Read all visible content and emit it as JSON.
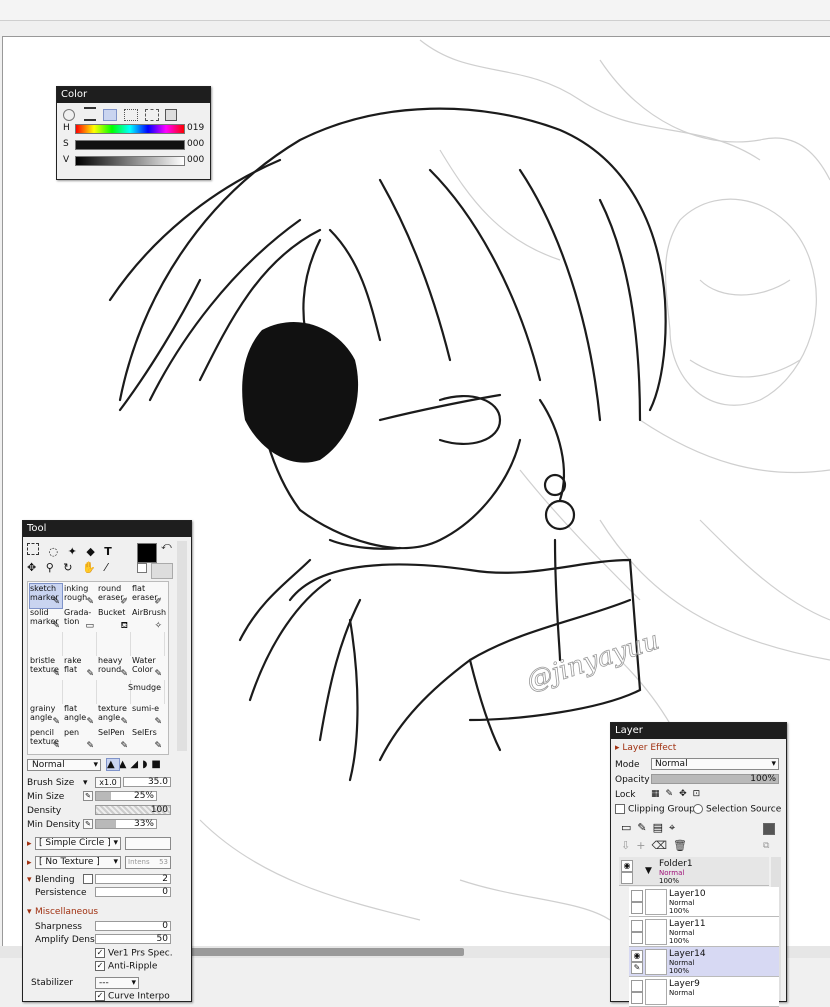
{
  "color_panel": {
    "title": "Color",
    "modes": [
      "wheel-icon",
      "rgb-sliders-icon",
      "hsv-sliders-icon",
      "grid-icon",
      "swatch-icon",
      "scratch-icon"
    ],
    "h": {
      "label": "H",
      "value": "019"
    },
    "s": {
      "label": "S",
      "value": "000"
    },
    "v": {
      "label": "V",
      "value": "000"
    }
  },
  "tool_panel": {
    "title": "Tool",
    "tools": [
      {
        "l1": "sketch",
        "l2": "marker",
        "sel": true
      },
      {
        "l1": "inking",
        "l2": "rough",
        "sel": false
      },
      {
        "l1": "round",
        "l2": "eraser",
        "sel": false
      },
      {
        "l1": "flat",
        "l2": "eraser",
        "sel": false
      },
      {
        "l1": "solid",
        "l2": "marker",
        "sel": false
      },
      {
        "l1": "Grada-",
        "l2": "tion",
        "sel": false
      },
      {
        "l1": "Bucket",
        "l2": "",
        "sel": false
      },
      {
        "l1": "AirBrush",
        "l2": "",
        "sel": false
      },
      {
        "l1": "bristle",
        "l2": "texture",
        "sel": false
      },
      {
        "l1": "rake",
        "l2": "flat",
        "sel": false
      },
      {
        "l1": "heavy",
        "l2": "round",
        "sel": false
      },
      {
        "l1": "Water",
        "l2": "Color",
        "sel": false
      },
      {
        "l1": "grainy",
        "l2": "angle",
        "sel": false
      },
      {
        "l1": "flat",
        "l2": "angle",
        "sel": false
      },
      {
        "l1": "texture",
        "l2": "angle",
        "sel": false
      },
      {
        "l1": "sumi-e",
        "l2": "",
        "sel": false
      },
      {
        "l1": "pencil",
        "l2": "texture",
        "sel": false
      },
      {
        "l1": "pen",
        "l2": "",
        "sel": false
      },
      {
        "l1": "SelPen",
        "l2": "",
        "sel": false
      },
      {
        "l1": "SelErs",
        "l2": "",
        "sel": false
      }
    ],
    "smudge_label": "Smudge",
    "blend_mode": "Normal",
    "brush_size": {
      "label": "Brush Size",
      "mult": "x1.0",
      "value": "35.0"
    },
    "min_size": {
      "label": "Min Size",
      "value": "25%",
      "fraction": 0.25
    },
    "density": {
      "label": "Density",
      "value": "100",
      "fraction": 1.0
    },
    "min_density": {
      "label": "Min Density",
      "value": "33%",
      "fraction": 0.33
    },
    "shape": "[ Simple Circle ]",
    "texture": "[ No Texture ]",
    "intens_label": "Intens",
    "intens_value": "53",
    "blending": {
      "label": "Blending",
      "value": "2"
    },
    "persistence": {
      "label": "Persistence",
      "value": "0"
    },
    "misc_label": "Miscellaneous",
    "sharpness": {
      "label": "Sharpness",
      "value": "0"
    },
    "amplify": {
      "label": "Amplify Dens.",
      "value": "50"
    },
    "ver1": "Ver1 Prs Spec.",
    "antiripple": "Anti-Ripple",
    "stabilizer": {
      "label": "Stabilizer",
      "value": "---"
    },
    "curve": "Curve Interpo"
  },
  "layer_panel": {
    "title": "Layer",
    "layer_effect": "Layer Effect",
    "mode_label": "Mode",
    "mode_value": "Normal",
    "opacity_label": "Opacity",
    "opacity_value": "100%",
    "lock_label": "Lock",
    "clipping": "Clipping Group",
    "selection_source": "Selection Source",
    "folder": {
      "name": "Folder1",
      "mode": "Normal",
      "opacity": "100%"
    },
    "layers": [
      {
        "name": "Layer10",
        "mode": "Normal",
        "opacity": "100%",
        "sel": false
      },
      {
        "name": "Layer11",
        "mode": "Normal",
        "opacity": "100%",
        "sel": false
      },
      {
        "name": "Layer14",
        "mode": "Normal",
        "opacity": "100%",
        "sel": true
      },
      {
        "name": "Layer9",
        "mode": "Normal",
        "opacity": "",
        "sel": false
      }
    ]
  },
  "artwork": {
    "signature": "@jinyayuu"
  },
  "colors": {
    "title_bar": "#1e1e1e",
    "selection": "#c9d4f0",
    "layer_selected": "#d7d9f3",
    "folder_mode": "#a0147a",
    "misc_heading": "#a03010"
  }
}
